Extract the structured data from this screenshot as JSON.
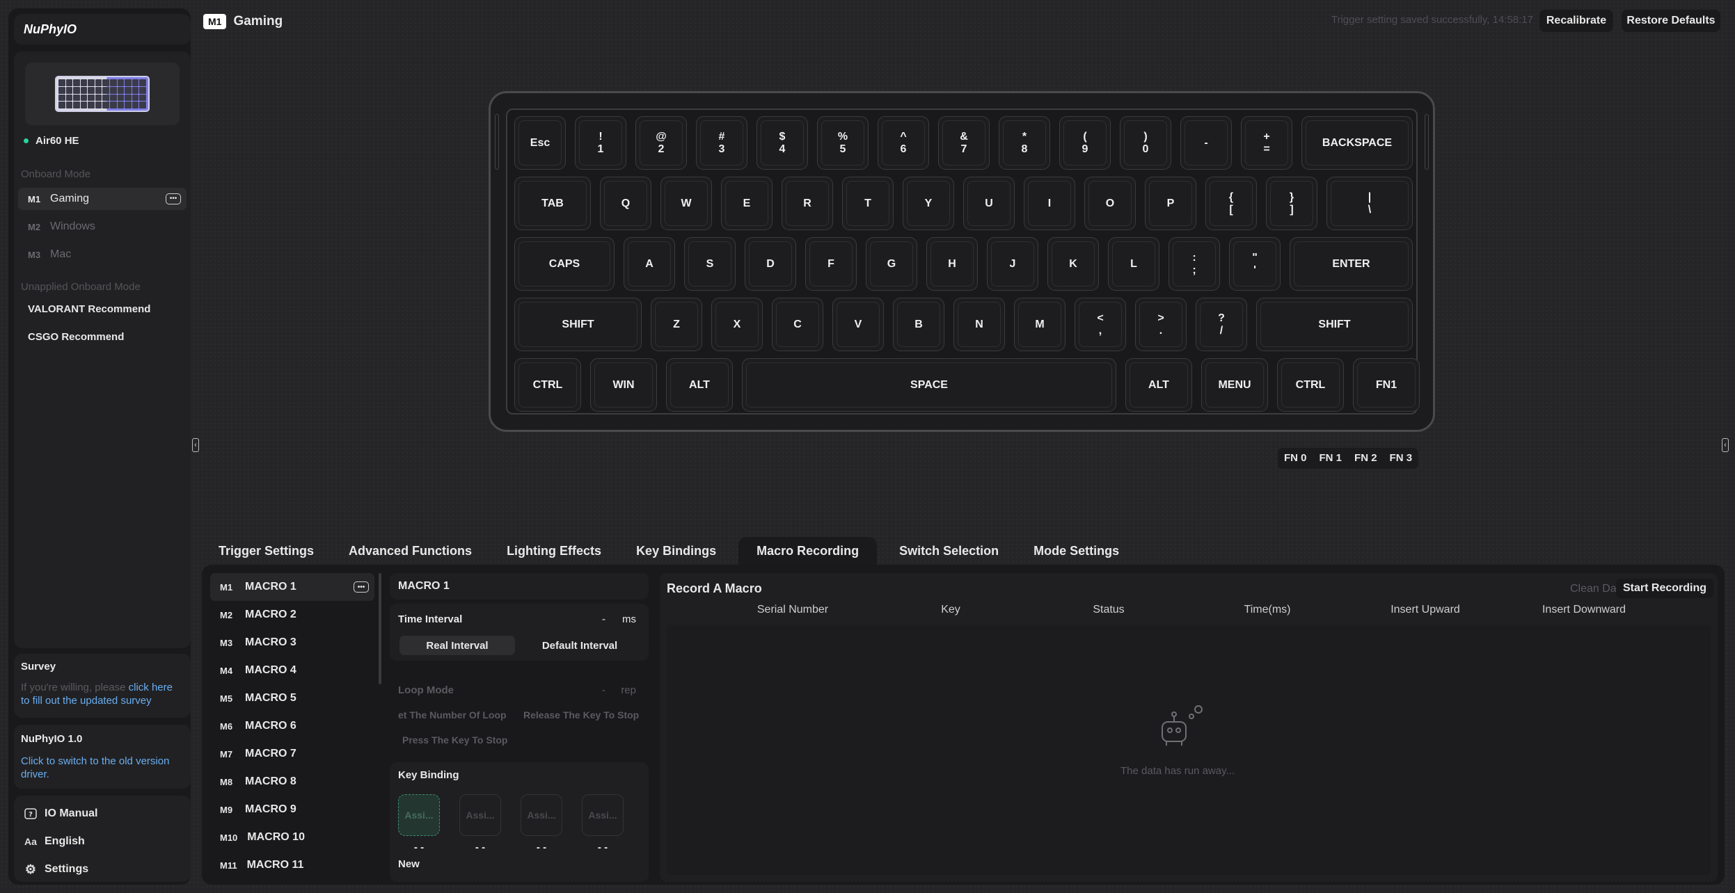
{
  "app": {
    "logo": "NuPhyIO"
  },
  "device": {
    "name": "Air60 HE"
  },
  "onboard": {
    "label": "Onboard Mode",
    "modes": [
      {
        "code": "M1",
        "name": "Gaming"
      },
      {
        "code": "M2",
        "name": "Windows"
      },
      {
        "code": "M3",
        "name": "Mac"
      }
    ]
  },
  "unapplied": {
    "label": "Unapplied Onboard Mode",
    "items": [
      "VALORANT Recommend",
      "CSGO Recommend"
    ]
  },
  "survey": {
    "title": "Survey",
    "text": "If you're willing, please ",
    "link1": "click here",
    "link2": "to fill out the updated survey"
  },
  "version": {
    "title": "NuPhyIO 1.0",
    "link": "Click to switch to the old version driver."
  },
  "footer": {
    "manual": "IO Manual",
    "language": "English",
    "settings": "Settings"
  },
  "header": {
    "badge": "M1",
    "title": "Gaming",
    "save_message": "Trigger setting saved successfully, 14:58:17",
    "recalibrate": "Recalibrate",
    "restore": "Restore Defaults"
  },
  "keyboard": {
    "rows": [
      [
        "Esc",
        "!\n1",
        "@\n2",
        "#\n3",
        "$\n4",
        "%\n5",
        "^\n6",
        "&\n7",
        "*\n8",
        "(\n9",
        ")\n0",
        "-",
        "+\n=",
        "BACKSPACE"
      ],
      [
        "TAB",
        "Q",
        "W",
        "E",
        "R",
        "T",
        "Y",
        "U",
        "I",
        "O",
        "P",
        "{\n[",
        "}\n]",
        "|\n\\"
      ],
      [
        "CAPS",
        "A",
        "S",
        "D",
        "F",
        "G",
        "H",
        "J",
        "K",
        "L",
        ":\n;",
        "\"\n'",
        "ENTER"
      ],
      [
        "SHIFT",
        "Z",
        "X",
        "C",
        "V",
        "B",
        "N",
        "M",
        "<\n,",
        ">\n.",
        "?\n/",
        "SHIFT"
      ],
      [
        "CTRL",
        "WIN",
        "ALT",
        "SPACE",
        "ALT",
        "MENU",
        "CTRL",
        "FN1"
      ]
    ]
  },
  "fn_layers": [
    "FN 0",
    "FN 1",
    "FN 2",
    "FN 3"
  ],
  "tabs": [
    "Trigger Settings",
    "Advanced Functions",
    "Lighting Effects",
    "Key Bindings",
    "Macro Recording",
    "Switch Selection",
    "Mode Settings"
  ],
  "macros": [
    {
      "code": "M1",
      "name": "MACRO 1"
    },
    {
      "code": "M2",
      "name": "MACRO 2"
    },
    {
      "code": "M3",
      "name": "MACRO 3"
    },
    {
      "code": "M4",
      "name": "MACRO 4"
    },
    {
      "code": "M5",
      "name": "MACRO 5"
    },
    {
      "code": "M6",
      "name": "MACRO 6"
    },
    {
      "code": "M7",
      "name": "MACRO 7"
    },
    {
      "code": "M8",
      "name": "MACRO 8"
    },
    {
      "code": "M9",
      "name": "MACRO 9"
    },
    {
      "code": "M10",
      "name": "MACRO 10"
    },
    {
      "code": "M11",
      "name": "MACRO 11"
    }
  ],
  "macro_config": {
    "title": "MACRO 1",
    "time_interval": {
      "label": "Time Interval",
      "value": "-",
      "unit": "ms",
      "option1": "Real Interval",
      "option2": "Default Interval"
    },
    "loop_mode": {
      "label": "Loop Mode",
      "value": "-",
      "unit": "rep",
      "opt1": "et The Number Of Loop",
      "opt2": "Release The Key To Stop",
      "opt3": "Press The Key To Stop"
    },
    "key_binding": {
      "label": "Key Binding",
      "slots": [
        "Assi...",
        "Assi...",
        "Assi...",
        "Assi..."
      ],
      "values": [
        "- -",
        "- -",
        "- -",
        "- -"
      ],
      "new": "New"
    }
  },
  "record": {
    "title": "Record A Macro",
    "clear": "Clean Data",
    "start": "Start Recording",
    "columns": [
      "Serial Number",
      "Key",
      "Status",
      "Time(ms)",
      "Insert Upward",
      "Insert Downward"
    ],
    "empty": "The data has run away..."
  }
}
